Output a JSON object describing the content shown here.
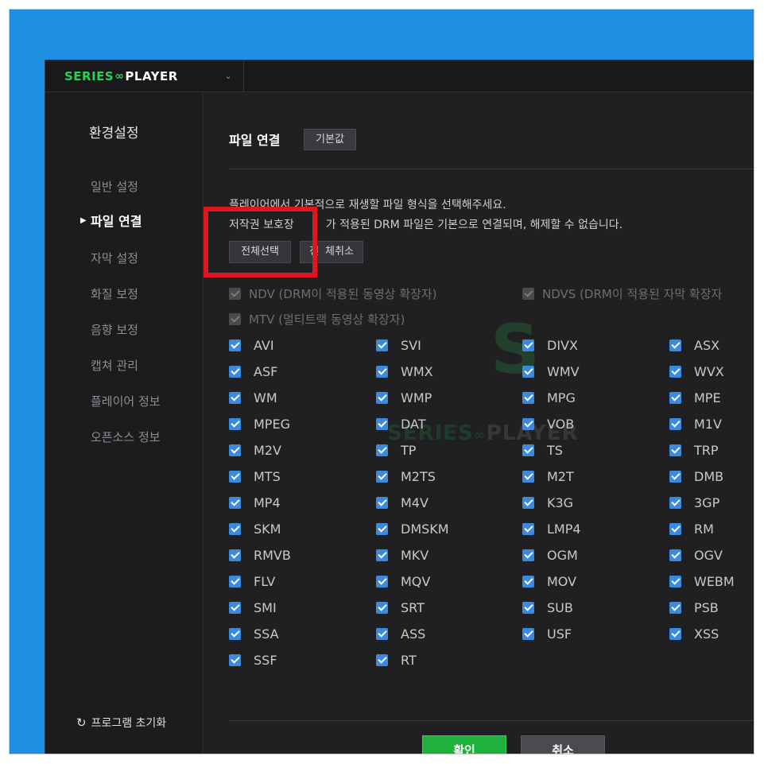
{
  "app": {
    "logo_series": "SERIES",
    "logo_infinity": "∞",
    "logo_player": "PLAYER",
    "accent": "#2bd05a",
    "checkbox_color": "#3a8be0"
  },
  "sidebar": {
    "title": "환경설정",
    "items": [
      {
        "label": "일반 설정",
        "active": false
      },
      {
        "label": "파일 연결",
        "active": true
      },
      {
        "label": "자막 설정",
        "active": false
      },
      {
        "label": "화질 보정",
        "active": false
      },
      {
        "label": "음향 보정",
        "active": false
      },
      {
        "label": "캡쳐 관리",
        "active": false
      },
      {
        "label": "플레이어 정보",
        "active": false
      },
      {
        "label": "오픈소스 정보",
        "active": false
      }
    ],
    "reset_label": "프로그램 초기화"
  },
  "main": {
    "title": "파일 연결",
    "default_button": "기본값",
    "desc_line1": "플레이어에서 기본적으로 재생할 파일 형식을 선택해주세요.",
    "desc_line2_a": "저작권 보호장",
    "desc_line2_b": "가 적용된 DRM 파일은 기본으로 연결되며, 해제할 수 없습니다.",
    "select_all": "전체선택",
    "deselect_all_a": "전",
    "deselect_all_b": "체취소",
    "drm": {
      "ndv_a": "NDV (D",
      "ndv_b": "RM이 적용된 동영상 확장자)",
      "ndvs": "NDVS (DRM이 적용된 자막 확장자",
      "mtv": "MTV (멀티트랙 동영상 확장자)"
    },
    "columns": [
      [
        "AVI",
        "ASF",
        "WM",
        "MPEG",
        "M2V",
        "MTS",
        "MP4",
        "SKM",
        "RMVB",
        "FLV",
        "SMI",
        "SSA",
        "SSF"
      ],
      [
        "SVI",
        "WMX",
        "WMP",
        "DAT",
        "TP",
        "M2TS",
        "M4V",
        "DMSKM",
        "MKV",
        "MQV",
        "SRT",
        "ASS",
        "RT"
      ],
      [
        "DIVX",
        "WMV",
        "MPG",
        "VOB",
        "TS",
        "M2T",
        "K3G",
        "LMP4",
        "OGM",
        "MOV",
        "SUB",
        "USF"
      ],
      [
        "ASX",
        "WVX",
        "MPE",
        "M1V",
        "TRP",
        "DMB",
        "3GP",
        "RM",
        "OGV",
        "WEBM",
        "PSB",
        "XSS"
      ]
    ],
    "ok_button": "확인",
    "cancel_button": "취소"
  }
}
